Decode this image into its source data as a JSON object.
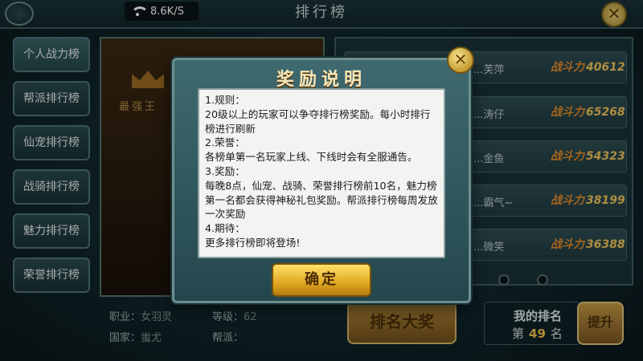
{
  "status": {
    "network_speed": "8.6K/S"
  },
  "header": {
    "title": "排行榜"
  },
  "sidebar": {
    "tabs": [
      {
        "label": "个人战力榜"
      },
      {
        "label": "帮派排行榜"
      },
      {
        "label": "仙宠排行榜"
      },
      {
        "label": "战骑排行榜"
      },
      {
        "label": "魅力排行榜"
      },
      {
        "label": "荣誉排行榜"
      }
    ]
  },
  "character": {
    "rank_title": "最强王",
    "profession_label": "职业：",
    "profession_value": "女羽灵",
    "level_label": "等级：",
    "level_value": "62",
    "nation_label": "国家：",
    "nation_value": "蚩尤",
    "guild_label": "帮派："
  },
  "ranking": {
    "power_label": "战斗力",
    "rows": [
      {
        "name": "...芙萍",
        "power": "40612"
      },
      {
        "name": "...涛仔",
        "power": "65268"
      },
      {
        "name": "...金鱼",
        "power": "54323"
      },
      {
        "name": "...霸气~",
        "power": "38199"
      },
      {
        "name": "...微笑",
        "power": "36388"
      }
    ]
  },
  "footer": {
    "rank_reward_button": "排名大奖",
    "my_rank_title": "我的排名",
    "my_rank_prefix": "第",
    "my_rank_value": "49",
    "my_rank_suffix": "名",
    "promote_button": "提升"
  },
  "modal": {
    "title": "奖励说明",
    "close_symbol": "✕",
    "lines": [
      "1.规则：",
      "20级以上的玩家可以争夺排行榜奖励。每小时排行榜进行刷新",
      "2.荣誉：",
      "各榜单第一名玩家上线、下线时会有全服通告。",
      "3.奖励：",
      "每晚8点，仙宠、战骑、荣誉排行榜前10名，魅力榜第一名都会获得神秘礼包奖励。帮派排行榜每周发放一次奖励",
      "4.期待：",
      "更多排行榜即将登场!"
    ],
    "confirm_button": "确定"
  }
}
